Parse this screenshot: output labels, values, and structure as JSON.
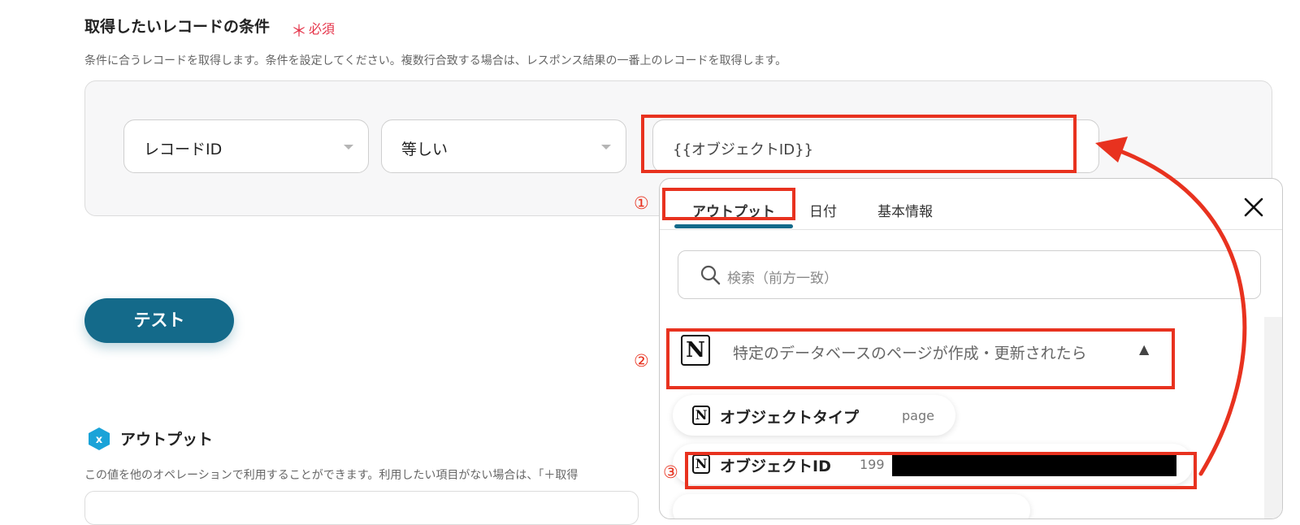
{
  "section": {
    "title": "取得したいレコードの条件",
    "required_mark": "＊",
    "required_label": "必須",
    "description": "条件に合うレコードを取得します。条件を設定してください。複数行合致する場合は、レスポンス結果の一番上のレコードを取得します。"
  },
  "condition": {
    "field_select": "レコードID",
    "operator_select": "等しい",
    "value": "{{オブジェクトID}}"
  },
  "test_button": "テスト",
  "output": {
    "title": "アウトプット",
    "description": "この値を他のオペレーションで利用することができます。利用したい項目がない場合は、「＋取得"
  },
  "popup": {
    "tabs": [
      "アウトプット",
      "日付",
      "基本情報"
    ],
    "search_placeholder": "検索（前方一致）",
    "group_label": "特定のデータベースのページが作成・更新されたら",
    "items": [
      {
        "name": "オブジェクトタイプ",
        "value": "page"
      },
      {
        "name": "オブジェクトID",
        "value": "199"
      }
    ]
  },
  "annotations": [
    "①",
    "②",
    "③"
  ],
  "logo_letter": "N",
  "colors": {
    "accent": "#146a8a",
    "annotation_red": "#e8321f",
    "required_red": "#e5344a"
  }
}
